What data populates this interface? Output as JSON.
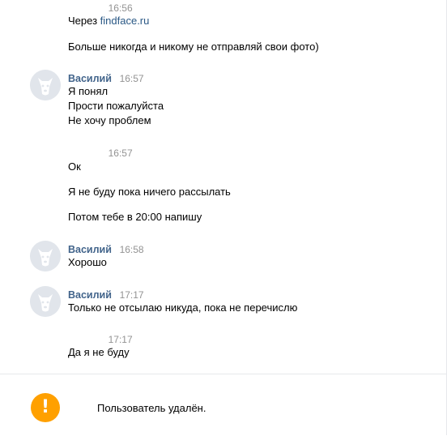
{
  "messages": [
    {
      "author": "",
      "time": "16:56",
      "avatar": "hidden",
      "lines": [
        {
          "prefix": "Через ",
          "link": "findface.ru"
        },
        {
          "text": "Больше никогда и никому не отправляй свои фото)"
        }
      ]
    },
    {
      "author": "Василий",
      "time": "16:57",
      "avatar": "default-dog-avatar-icon",
      "lines": [
        {
          "text": "Я понял"
        },
        {
          "text": "Прости пожалуйста"
        },
        {
          "text": "Не хочу проблем"
        }
      ]
    },
    {
      "author": "",
      "time": "16:57",
      "avatar": "hidden",
      "lines": [
        {
          "text": "Ок"
        },
        {
          "text": "Я не буду пока ничего рассылать"
        },
        {
          "text": "Потом тебе в 20:00 напишу"
        }
      ]
    },
    {
      "author": "Василий",
      "time": "16:58",
      "avatar": "default-dog-avatar-icon",
      "lines": [
        {
          "text": "Хорошо"
        }
      ]
    },
    {
      "author": "Василий",
      "time": "17:17",
      "avatar": "default-dog-avatar-icon",
      "lines": [
        {
          "text": "Только не отсылаю никуда, пока не перечислю"
        }
      ]
    },
    {
      "author": "",
      "time": "17:17",
      "avatar": "hidden",
      "lines": [
        {
          "text": "Да я не буду"
        }
      ]
    }
  ],
  "footer": {
    "icon": "warning-icon",
    "icon_glyph": "!",
    "text": "Пользователь удалён."
  },
  "colors": {
    "author": "#42648b",
    "link": "#2a5885",
    "time": "#939393",
    "warning": "#ffa000"
  }
}
